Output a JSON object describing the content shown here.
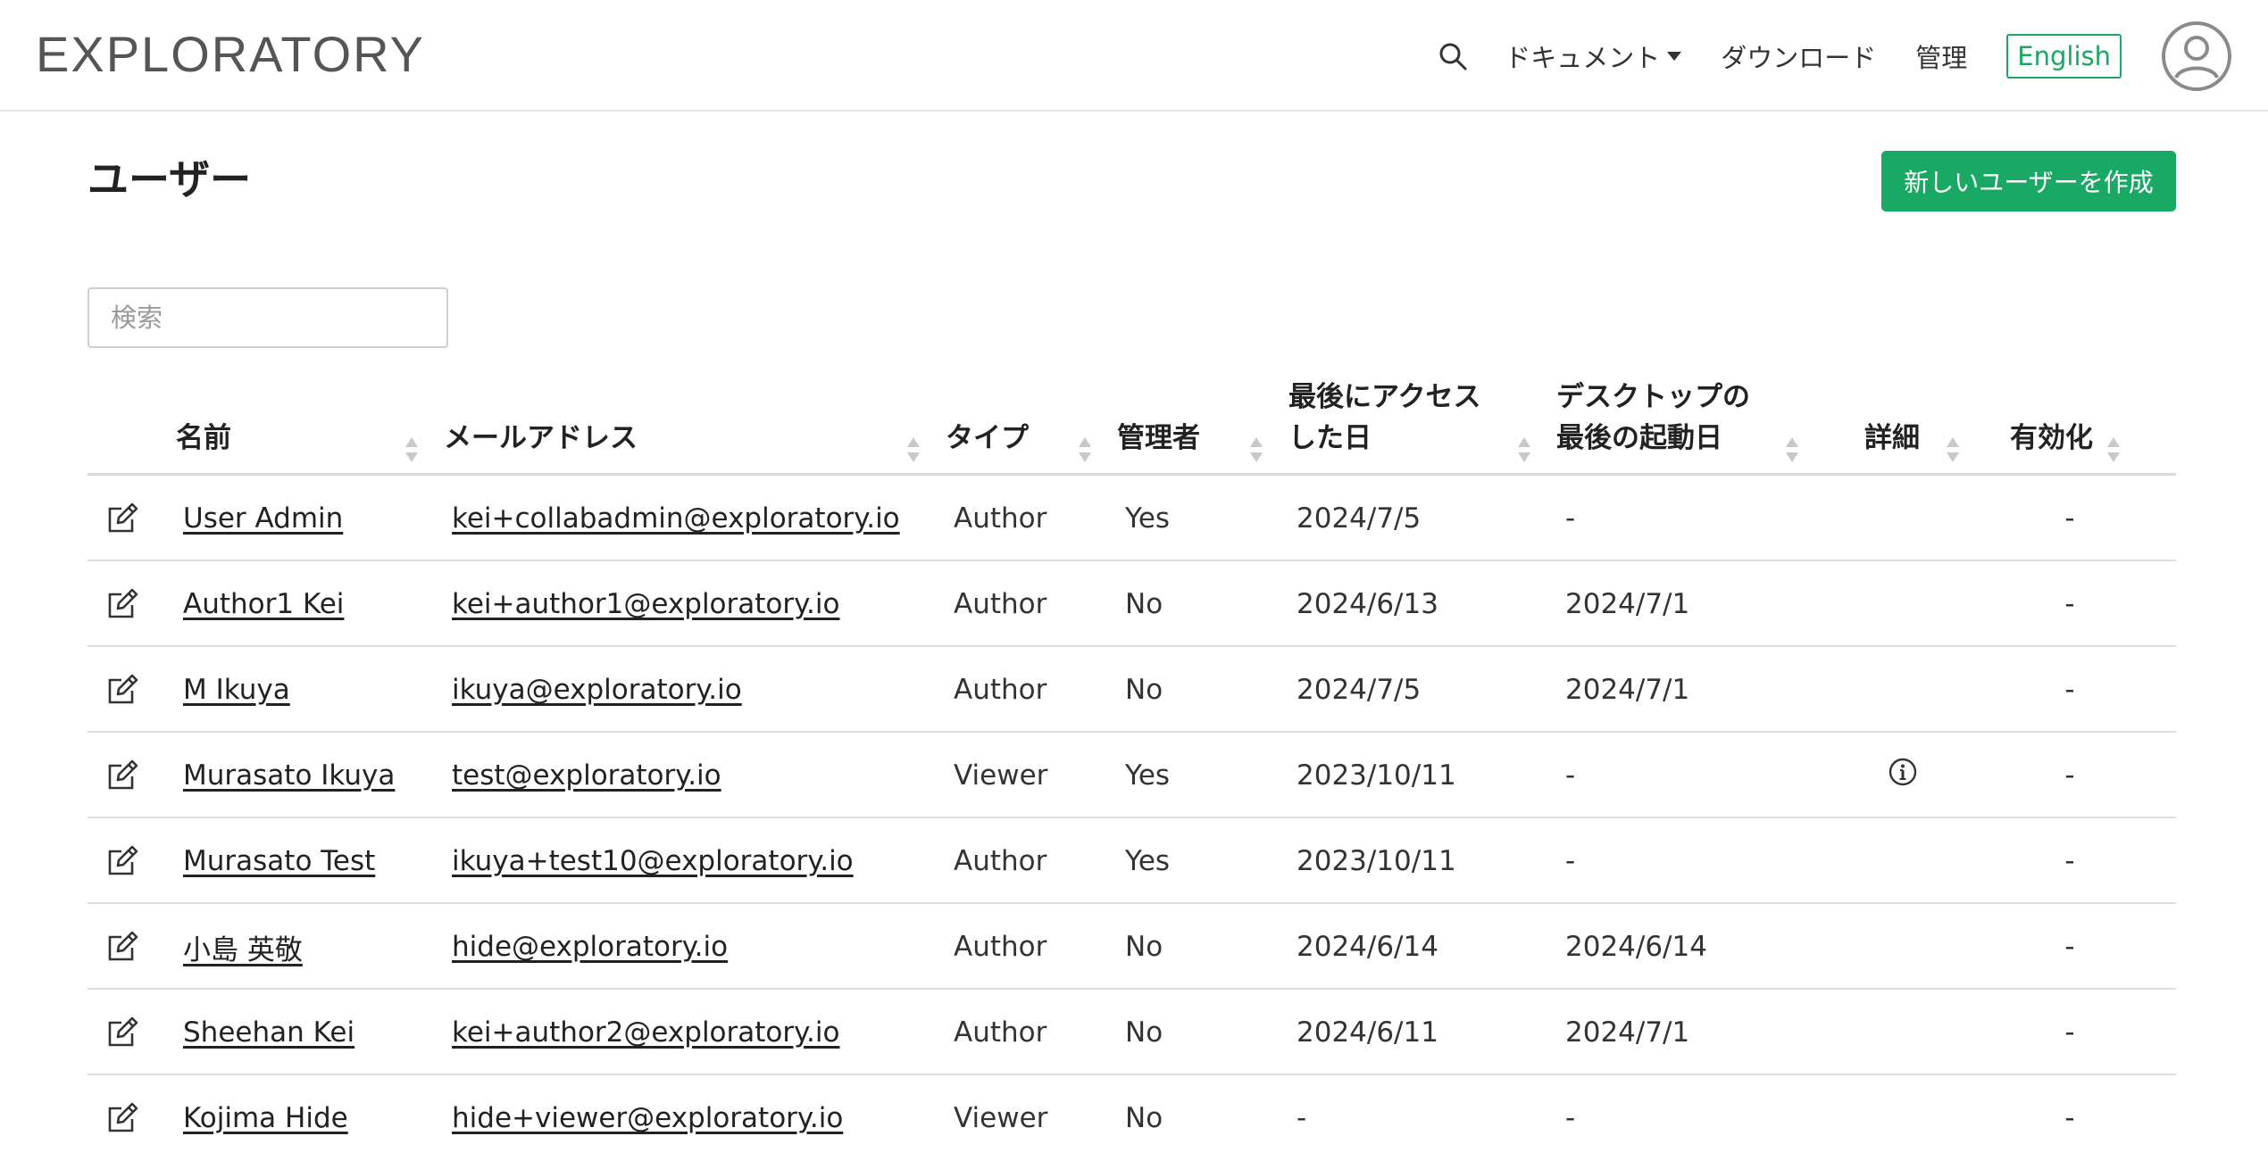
{
  "header": {
    "logo": "EXPLORATORY",
    "nav": {
      "docs_label": "ドキュメント",
      "download_label": "ダウンロード",
      "admin_label": "管理",
      "language_label": "English"
    }
  },
  "page": {
    "title": "ユーザー",
    "create_button": "新しいユーザーを作成",
    "search_placeholder": "検索"
  },
  "table": {
    "columns": {
      "name": "名前",
      "email": "メールアドレス",
      "type": "タイプ",
      "admin": "管理者",
      "last_access_1": "最後にアクセス",
      "last_access_2": "した日",
      "desktop_1": "デスクトップの",
      "desktop_2": "最後の起動日",
      "detail": "詳細",
      "enabled": "有効化"
    },
    "rows": [
      {
        "name": "User Admin",
        "email": "kei+collabadmin@exploratory.io",
        "type": "Author",
        "admin": "Yes",
        "last_access": "2024/7/5",
        "desktop": "-",
        "detail": "",
        "enabled": "-"
      },
      {
        "name": "Author1 Kei",
        "email": "kei+author1@exploratory.io",
        "type": "Author",
        "admin": "No",
        "last_access": "2024/6/13",
        "desktop": "2024/7/1",
        "detail": "",
        "enabled": "-"
      },
      {
        "name": "M Ikuya",
        "email": "ikuya@exploratory.io",
        "type": "Author",
        "admin": "No",
        "last_access": "2024/7/5",
        "desktop": "2024/7/1",
        "detail": "",
        "enabled": "-"
      },
      {
        "name": "Murasato Ikuya",
        "email": "test@exploratory.io",
        "type": "Viewer",
        "admin": "Yes",
        "last_access": "2023/10/11",
        "desktop": "-",
        "detail": "info-icon",
        "enabled": "-"
      },
      {
        "name": "Murasato Test",
        "email": "ikuya+test10@exploratory.io",
        "type": "Author",
        "admin": "Yes",
        "last_access": "2023/10/11",
        "desktop": "-",
        "detail": "",
        "enabled": "-"
      },
      {
        "name": "小島 英敬",
        "email": "hide@exploratory.io",
        "type": "Author",
        "admin": "No",
        "last_access": "2024/6/14",
        "desktop": "2024/6/14",
        "detail": "",
        "enabled": "-"
      },
      {
        "name": "Sheehan Kei",
        "email": "kei+author2@exploratory.io",
        "type": "Author",
        "admin": "No",
        "last_access": "2024/6/11",
        "desktop": "2024/7/1",
        "detail": "",
        "enabled": "-"
      },
      {
        "name": "Kojima Hide",
        "email": "hide+viewer@exploratory.io",
        "type": "Viewer",
        "admin": "No",
        "last_access": "-",
        "desktop": "-",
        "detail": "",
        "enabled": "-"
      }
    ]
  },
  "colors": {
    "accent": "#1aa865",
    "border": "#dedede"
  }
}
